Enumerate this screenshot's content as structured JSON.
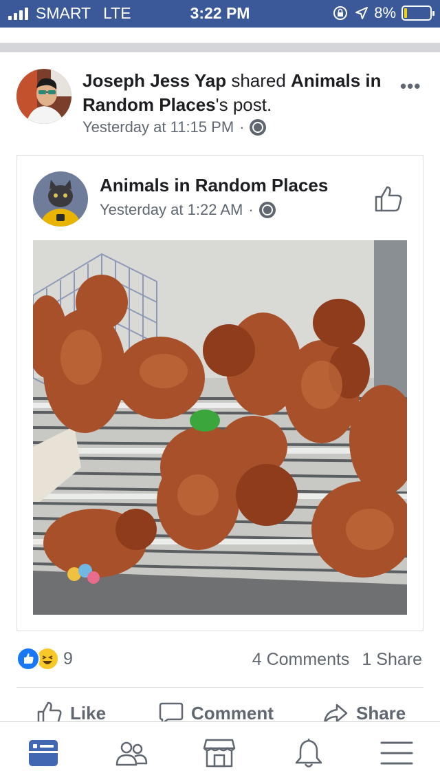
{
  "status_bar": {
    "carrier": "SMART",
    "network": "LTE",
    "time": "3:22 PM",
    "battery": "8%",
    "battery_level": 0.08
  },
  "post": {
    "author": "Joseph Jess Yap",
    "action_text": " shared ",
    "shared_page": "Animals in Random Places",
    "possessive_suffix": "'s post.",
    "timestamp": "Yesterday at 11:15 PM",
    "more_icon": "more-dots-icon",
    "privacy_icon": "globe-icon"
  },
  "shared_post": {
    "page_name": "Animals in Random Places",
    "timestamp": "Yesterday at 1:22 AM",
    "like_page_icon": "thumbs-up-icon"
  },
  "engagement": {
    "reaction_count": "9",
    "reactions": [
      "like",
      "haha"
    ],
    "comments": "4 Comments",
    "shares": "1 Share"
  },
  "actions": {
    "like": "Like",
    "comment": "Comment",
    "share": "Share"
  },
  "tab_bar": {
    "tabs": [
      "news-feed-icon",
      "friends-icon",
      "marketplace-icon",
      "notifications-icon",
      "menu-icon"
    ],
    "active": "news-feed-icon"
  },
  "colors": {
    "brand": "#3b5998",
    "like_blue": "#1877f2",
    "active_tab": "#4267b2",
    "muted_text": "#606770"
  }
}
